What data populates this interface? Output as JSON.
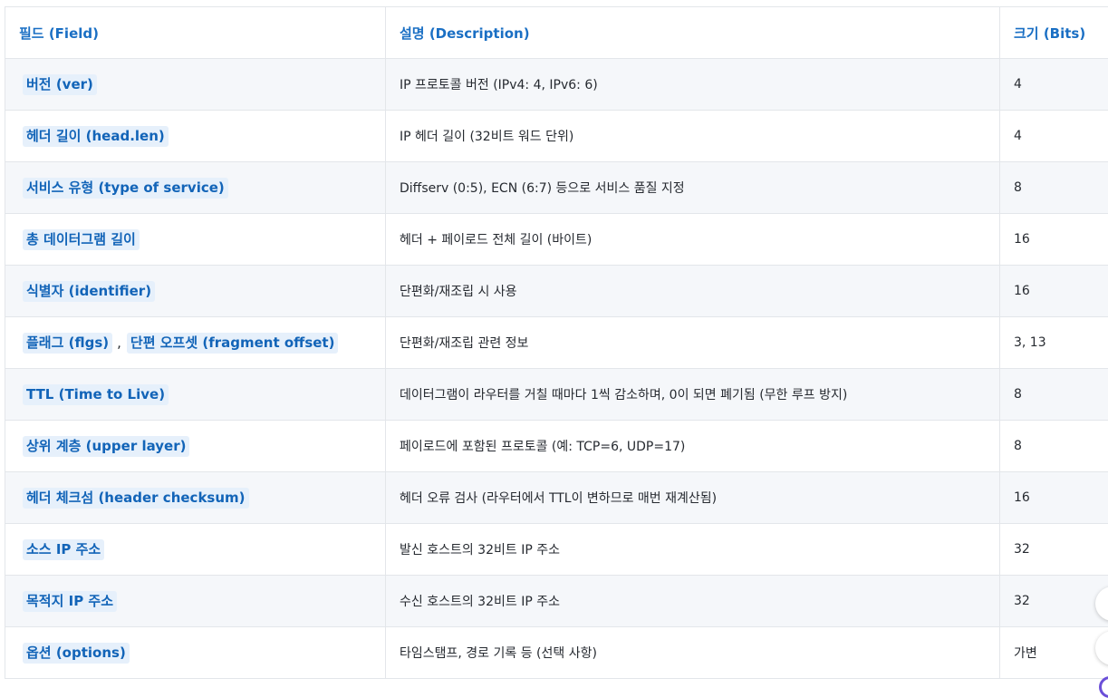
{
  "table": {
    "headers": {
      "field": "필드 (Field)",
      "description": "설명 (Description)",
      "size": "크기 (Bits)"
    },
    "rows": [
      {
        "field": "버전 (ver)",
        "description": "IP 프로토콜 버전 (IPv4: 4, IPv6: 6)",
        "size": "4"
      },
      {
        "field": "헤더 길이 (head.len)",
        "description": "IP 헤더 길이 (32비트 워드 단위)",
        "size": "4"
      },
      {
        "field": "서비스 유형 (type of service)",
        "description": "Diffserv (0:5), ECN (6:7) 등으로 서비스 품질 지정",
        "size": "8"
      },
      {
        "field": "총 데이터그램 길이",
        "description": "헤더 + 페이로드 전체 길이 (바이트)",
        "size": "16"
      },
      {
        "field": "식별자 (identifier)",
        "description": "단편화/재조립 시 사용",
        "size": "16"
      },
      {
        "field": "플래그 (flgs)",
        "field2": "단편 오프셋 (fragment offset)",
        "separator": ",",
        "description": "단편화/재조립 관련 정보",
        "size": "3, 13"
      },
      {
        "field": "TTL (Time to Live)",
        "description": "데이터그램이 라우터를 거칠 때마다 1씩 감소하며, 0이 되면 폐기됨 (무한 루프 방지)",
        "size": "8"
      },
      {
        "field": "상위 계층 (upper layer)",
        "description": "페이로드에 포함된 프로토콜 (예: TCP=6, UDP=17)",
        "size": "8"
      },
      {
        "field": "헤더 체크섬 (header checksum)",
        "description": "헤더 오류 검사 (라우터에서 TTL이 변하므로 매번 재계산됨)",
        "size": "16"
      },
      {
        "field": "소스 IP 주소",
        "description": "발신 호스트의 32비트 IP 주소",
        "size": "32"
      },
      {
        "field": "목적지 IP 주소",
        "description": "수신 호스트의 32비트 IP 주소",
        "size": "32"
      },
      {
        "field": "옵션 (options)",
        "description": "타임스탬프, 경로 기록 등 (선택 사항)",
        "size": "가변"
      }
    ]
  },
  "colors": {
    "header_text": "#1a6fc4",
    "pill_bg": "#e6f0fb",
    "pill_text": "#1264b8",
    "row_alt_bg": "#f5f7fa",
    "border": "#e3e6ea"
  }
}
